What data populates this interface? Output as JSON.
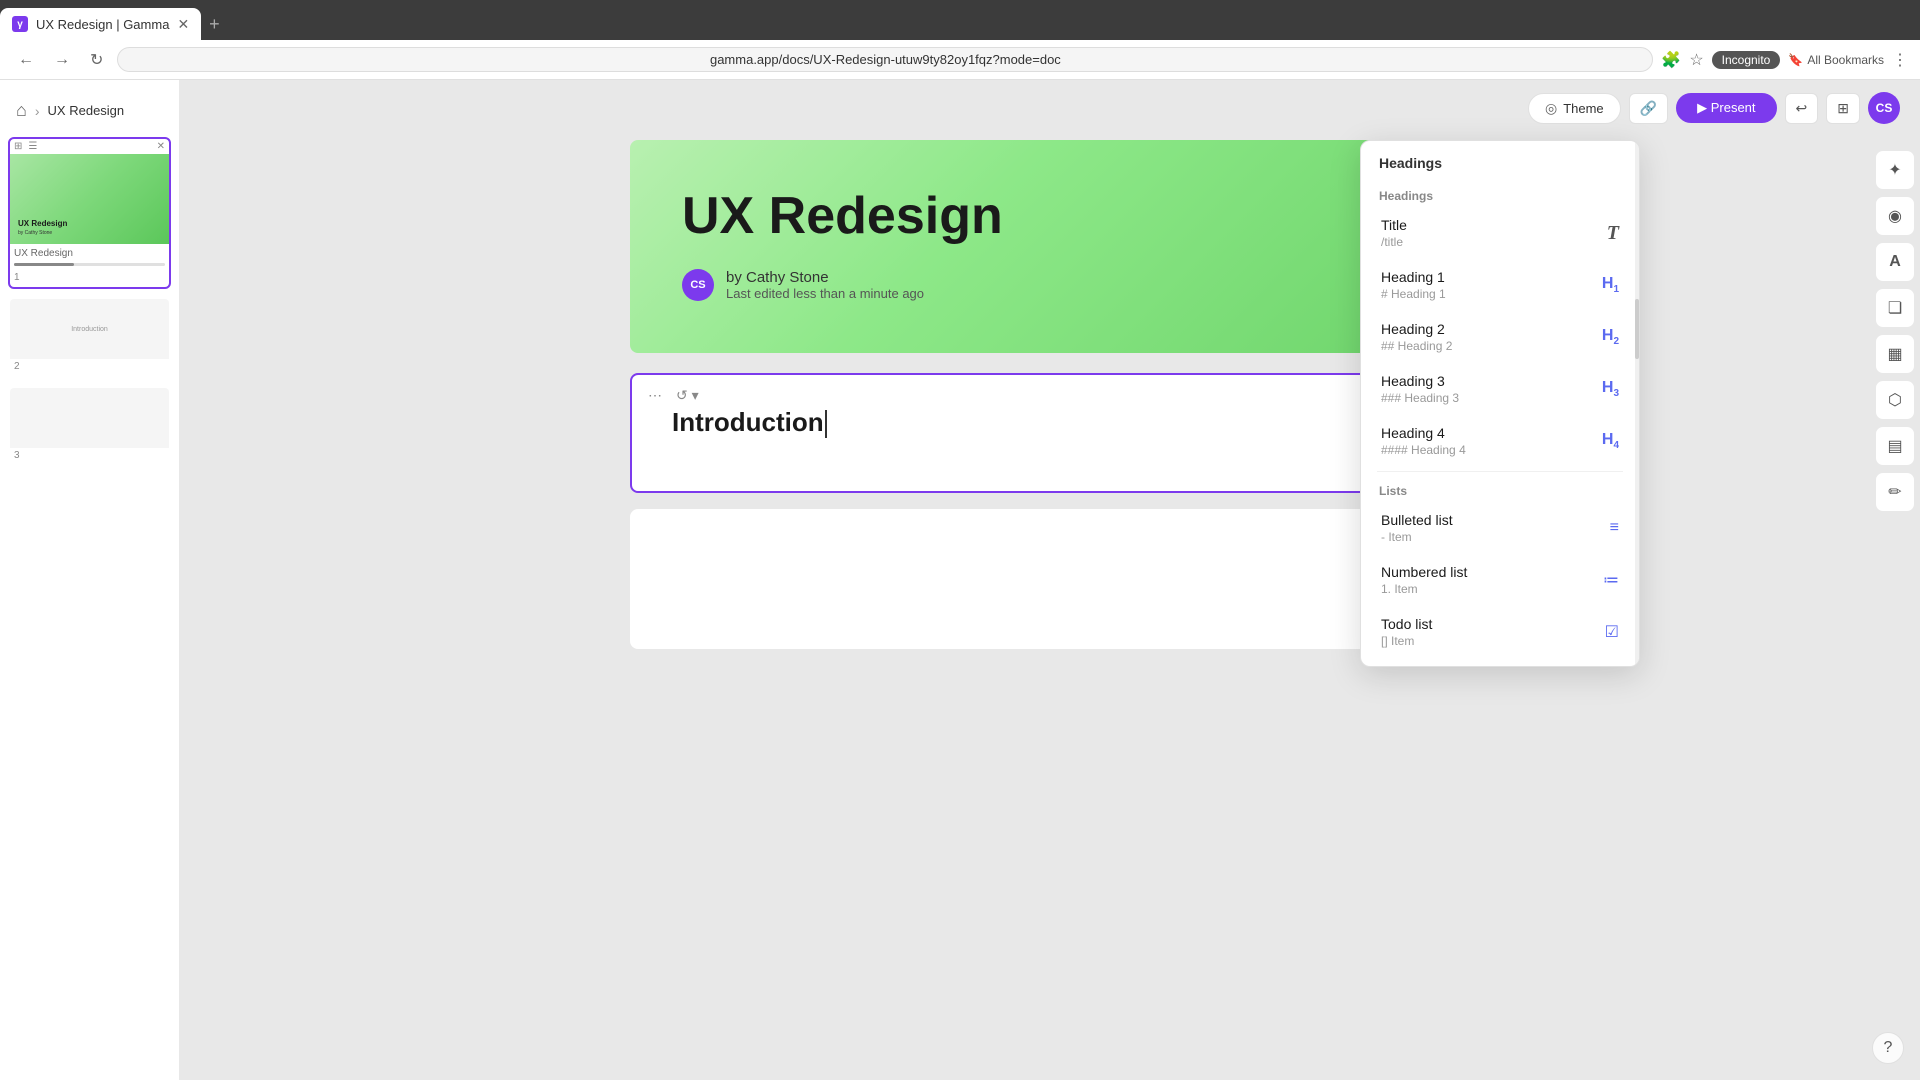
{
  "browser": {
    "tab_title": "UX Redesign | Gamma",
    "url": "gamma.app/docs/UX-Redesign-utuw9ty82oy1fqz?mode=doc",
    "incognito_label": "Incognito",
    "bookmarks_label": "All Bookmarks"
  },
  "header": {
    "home_icon": "⌂",
    "breadcrumb_separator": "›",
    "breadcrumb_text": "UX Redesign",
    "theme_label": "Theme",
    "avatar_label": "CS"
  },
  "hero": {
    "title": "UX Redesign",
    "author_name": "by Cathy Stone",
    "author_initials": "CS",
    "last_edited": "Last edited less than a minute ago"
  },
  "slides": [
    {
      "num": "1",
      "label": "UX Redesign",
      "active": true
    },
    {
      "num": "2",
      "label": "Introduction",
      "active": false
    },
    {
      "num": "3",
      "label": "",
      "active": false
    }
  ],
  "cards": [
    {
      "id": "introduction",
      "content": "Introduction",
      "active": true,
      "has_cursor": true
    },
    {
      "id": "empty",
      "content": "",
      "active": false,
      "has_cursor": false
    }
  ],
  "dropdown": {
    "title": "Headings",
    "sections": [
      {
        "label": "Headings",
        "items": [
          {
            "name": "Title",
            "sub": "/title",
            "icon": "T",
            "icon_class": "title-icon"
          },
          {
            "name": "Heading 1",
            "sub": "# Heading 1",
            "icon": "H1",
            "icon_class": "h1-icon"
          },
          {
            "name": "Heading 2",
            "sub": "## Heading 2",
            "icon": "H2",
            "icon_class": "h2-icon"
          },
          {
            "name": "Heading 3",
            "sub": "### Heading 3",
            "icon": "H3",
            "icon_class": "h3-icon"
          },
          {
            "name": "Heading 4",
            "sub": "#### Heading 4",
            "icon": "H4",
            "icon_class": "h4-icon"
          }
        ]
      },
      {
        "label": "Lists",
        "items": [
          {
            "name": "Bulleted list",
            "sub": "- Item",
            "icon": "≡",
            "icon_class": "list-icon"
          },
          {
            "name": "Numbered list",
            "sub": "1. Item",
            "icon": "≔",
            "icon_class": "list-icon"
          },
          {
            "name": "Todo list",
            "sub": "[] Item",
            "icon": "☑",
            "icon_class": "list-icon"
          }
        ]
      }
    ]
  },
  "right_tools": [
    "✦",
    "◉",
    "A",
    "❏",
    "▦",
    "⬡",
    "▤",
    "✏"
  ],
  "help_icon": "?"
}
